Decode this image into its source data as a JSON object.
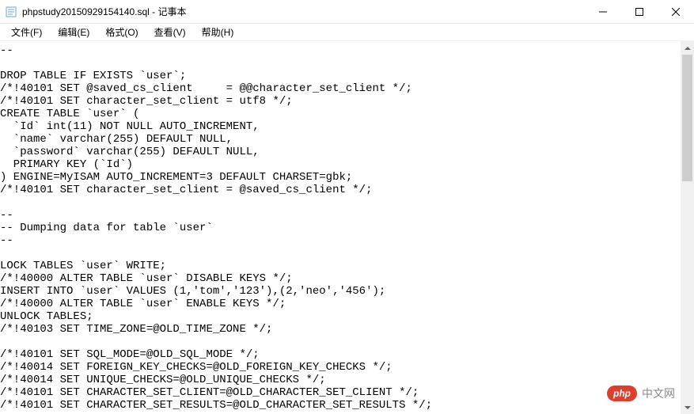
{
  "window": {
    "filename": "phpstudy20150929154140.sql",
    "app_name": "记事本",
    "title_separator": " - "
  },
  "menu": {
    "file": "文件(F)",
    "edit": "编辑(E)",
    "format": "格式(O)",
    "view": "查看(V)",
    "help": "帮助(H)"
  },
  "content": "--\n\nDROP TABLE IF EXISTS `user`;\n/*!40101 SET @saved_cs_client     = @@character_set_client */;\n/*!40101 SET character_set_client = utf8 */;\nCREATE TABLE `user` (\n  `Id` int(11) NOT NULL AUTO_INCREMENT,\n  `name` varchar(255) DEFAULT NULL,\n  `password` varchar(255) DEFAULT NULL,\n  PRIMARY KEY (`Id`)\n) ENGINE=MyISAM AUTO_INCREMENT=3 DEFAULT CHARSET=gbk;\n/*!40101 SET character_set_client = @saved_cs_client */;\n\n--\n-- Dumping data for table `user`\n--\n\nLOCK TABLES `user` WRITE;\n/*!40000 ALTER TABLE `user` DISABLE KEYS */;\nINSERT INTO `user` VALUES (1,'tom','123'),(2,'neo','456');\n/*!40000 ALTER TABLE `user` ENABLE KEYS */;\nUNLOCK TABLES;\n/*!40103 SET TIME_ZONE=@OLD_TIME_ZONE */;\n\n/*!40101 SET SQL_MODE=@OLD_SQL_MODE */;\n/*!40014 SET FOREIGN_KEY_CHECKS=@OLD_FOREIGN_KEY_CHECKS */;\n/*!40014 SET UNIQUE_CHECKS=@OLD_UNIQUE_CHECKS */;\n/*!40101 SET CHARACTER_SET_CLIENT=@OLD_CHARACTER_SET_CLIENT */;\n/*!40101 SET CHARACTER_SET_RESULTS=@OLD_CHARACTER_SET_RESULTS */;",
  "watermark": {
    "badge": "php",
    "text": "中文网"
  }
}
